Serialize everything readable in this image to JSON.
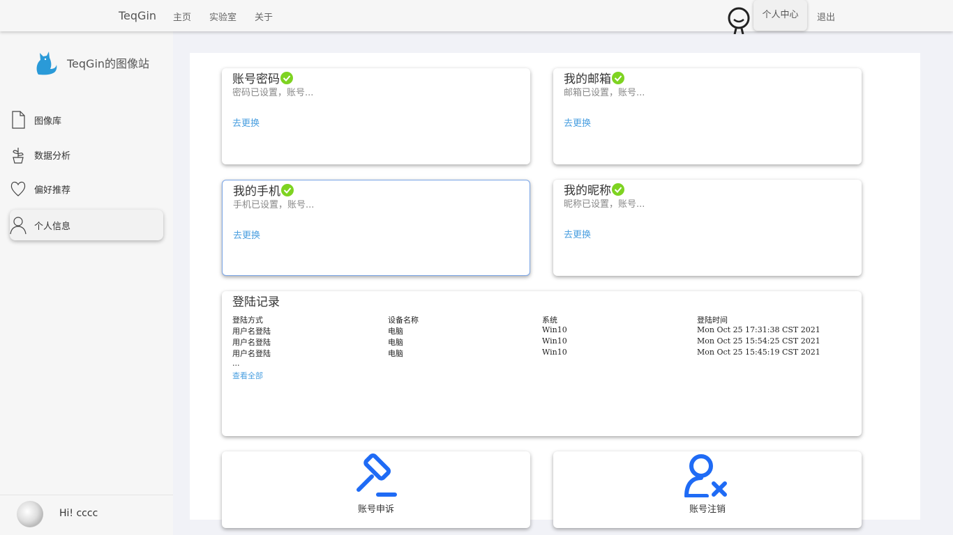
{
  "header": {
    "brand": "TeqGin",
    "nav": [
      "主页",
      "实验室",
      "关于"
    ],
    "user_center": "个人中心",
    "logout": "退出"
  },
  "sidebar": {
    "site_title": "TeqGin的图像站",
    "items": [
      {
        "label": "图像库",
        "icon": "file-icon"
      },
      {
        "label": "数据分析",
        "icon": "plant-icon"
      },
      {
        "label": "偏好推荐",
        "icon": "heart-icon"
      },
      {
        "label": "个人信息",
        "icon": "person-icon",
        "active": true
      }
    ],
    "greeting": "Hi! cccc"
  },
  "cards": [
    {
      "title": "账号密码",
      "subtitle": "密码已设置，账号...",
      "link": "去更换"
    },
    {
      "title": "我的邮箱",
      "subtitle": "邮箱已设置，账号...",
      "link": "去更换"
    },
    {
      "title": "我的手机",
      "subtitle": "手机已设置，账号...",
      "link": "去更换"
    },
    {
      "title": "我的昵称",
      "subtitle": "昵称已设置，账号...",
      "link": "去更换"
    }
  ],
  "login_log": {
    "title": "登陆记录",
    "headers": [
      "登陆方式",
      "设备名称",
      "系统",
      "登陆时间"
    ],
    "rows": [
      [
        "用户名登陆",
        "电脑",
        "Win10",
        "Mon Oct 25 17:31:38 CST 2021"
      ],
      [
        "用户名登陆",
        "电脑",
        "Win10",
        "Mon Oct 25 15:54:25 CST 2021"
      ],
      [
        "用户名登陆",
        "电脑",
        "Win10",
        "Mon Oct 25 15:45:19 CST 2021"
      ]
    ],
    "ellipsis": "...",
    "view_all": "查看全部"
  },
  "actions": [
    {
      "label": "账号申诉",
      "icon": "gavel-icon"
    },
    {
      "label": "账号注销",
      "icon": "user-remove-icon"
    }
  ],
  "colors": {
    "accent": "#4a9fe0",
    "check": "#7ed321",
    "action_icon": "#1f6bf5",
    "logo": "#2a9ad8"
  }
}
